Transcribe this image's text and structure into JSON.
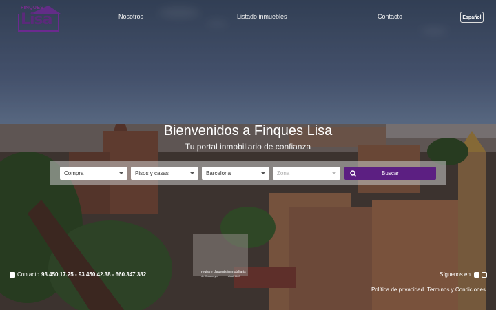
{
  "header": {
    "logo_small": "FINQUES",
    "logo_big": "Lisa",
    "nav": [
      "Nosotros",
      "Listado inmuebles",
      "Contacto"
    ],
    "language": "Español"
  },
  "hero": {
    "title": "Bienvenidos a Finques Lisa",
    "subtitle": "Tu portal inmobiliario de confianza"
  },
  "search": {
    "operation": "Compra",
    "property_type": "Pisos y casas",
    "city": "Barcelona",
    "zone_placeholder": "Zona",
    "button_label": "Buscar"
  },
  "footer": {
    "contact_label": "Contacto",
    "phones": "93.450.17.25 - 93 450.42.38 - 660.347.382",
    "registre_line1": "registre d'agents immobiliaris",
    "registre_line2": "de Catalunya",
    "registre_number": "aicat 1183",
    "follow_label": "Síguenos en",
    "privacy": "Política de privacidad",
    "terms": "Terminos y Condiciones"
  },
  "colors": {
    "brand": "#5c1f82",
    "logo": "#6b2a8f"
  },
  "icons": [
    "search-icon",
    "phone-icon",
    "facebook-icon",
    "instagram-icon",
    "caret-down-icon"
  ]
}
